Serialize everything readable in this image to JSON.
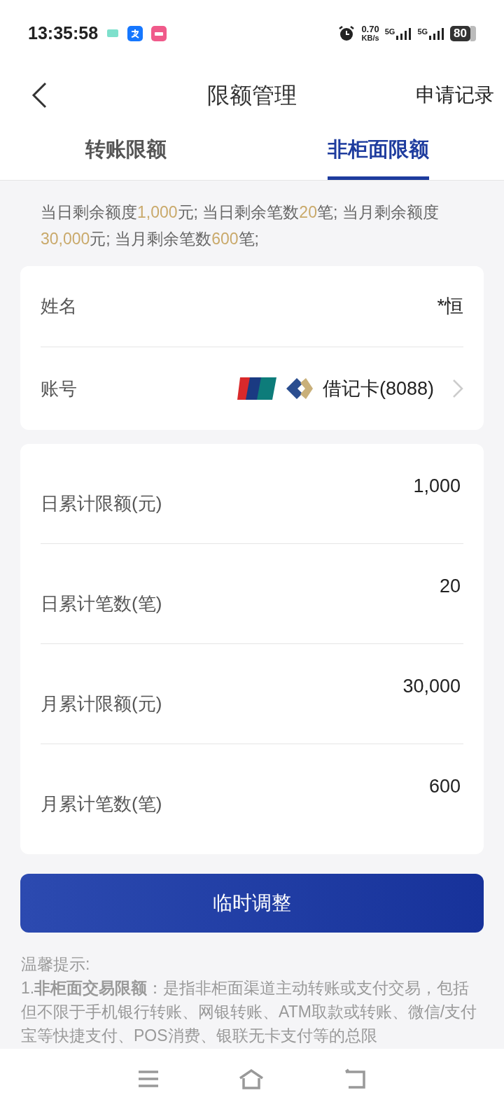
{
  "status_bar": {
    "time": "13:35:58",
    "speed": "0.70",
    "speed_unit": "KB/s",
    "network_1": "5G",
    "network_2": "5G",
    "battery": "80"
  },
  "header": {
    "title": "限额管理",
    "action": "申请记录"
  },
  "tabs": [
    {
      "label": "转账限额",
      "selected": false
    },
    {
      "label": "非柜面限额",
      "selected": true
    }
  ],
  "summary": [
    {
      "kind": "plain",
      "text": "当日剩余额度"
    },
    {
      "kind": "highlight",
      "text": "1,000"
    },
    {
      "kind": "plain",
      "text": "元; 当日剩余笔数"
    },
    {
      "kind": "highlight",
      "text": "20"
    },
    {
      "kind": "plain",
      "text": "笔; 当月剩余额度"
    },
    {
      "kind": "highlight",
      "text": "30,000"
    },
    {
      "kind": "plain",
      "text": "元; 当月剩余笔数"
    },
    {
      "kind": "highlight",
      "text": "600"
    },
    {
      "kind": "plain",
      "text": "笔;"
    }
  ],
  "account": {
    "name_label": "姓名",
    "name_value": "*恒",
    "account_label": "账号",
    "account_value": "借记卡(8088)"
  },
  "limits": [
    {
      "label": "日累计限额(元)",
      "value": "1,000"
    },
    {
      "label": "日累计笔数(笔)",
      "value": "20"
    },
    {
      "label": "月累计限额(元)",
      "value": "30,000"
    },
    {
      "label": "月累计笔数(笔)",
      "value": "600"
    }
  ],
  "button": "临时调整",
  "tips": {
    "title": "温馨提示:",
    "body": "1.**非柜面交易限额**：是指非柜面渠道主动转账或支付交易，包括但不限于手机银行转账、网银转账、ATM取款或转账、微信/支付宝等快捷支付、POS消费、银联无卡支付等的总限"
  }
}
